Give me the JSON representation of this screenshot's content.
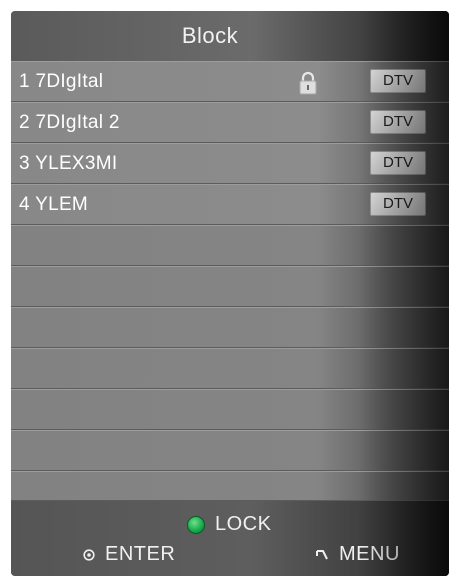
{
  "header": {
    "title": "Block"
  },
  "channels": [
    {
      "name": "1 7DIgItal",
      "type": "DTV",
      "locked": true
    },
    {
      "name": "2 7DIgItal 2",
      "type": "DTV",
      "locked": false
    },
    {
      "name": "3 YLEX3MI",
      "type": "DTV",
      "locked": false
    },
    {
      "name": "4 YLEM",
      "type": "DTV",
      "locked": false
    }
  ],
  "footer": {
    "lock_label": "LOCK",
    "enter_label": "ENTER",
    "menu_label": "MENU"
  },
  "colors": {
    "lock_dot": "#14a84a",
    "panel": "#7a7a7a",
    "badge": "#dcdcdc"
  },
  "icons": [
    "lock-icon",
    "green-button-icon",
    "enter-icon",
    "back-icon"
  ]
}
